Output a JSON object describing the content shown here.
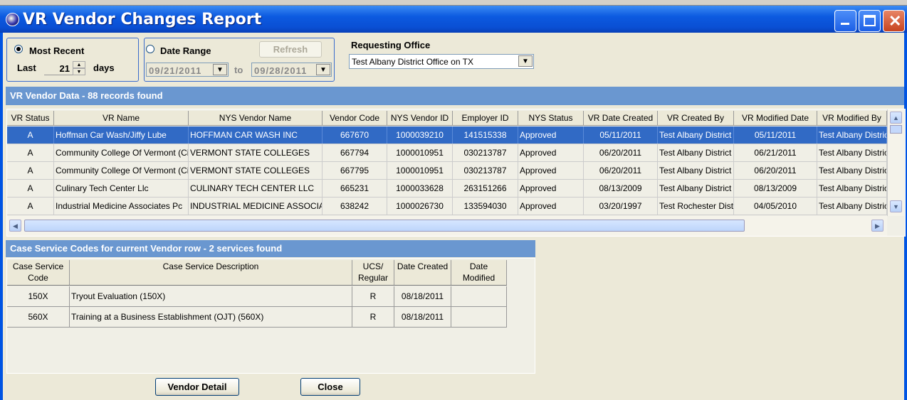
{
  "window": {
    "title": "VR Vendor Changes Report",
    "icon": "globe-icon"
  },
  "filters": {
    "most_recent_label": "Most Recent",
    "most_recent_selected": true,
    "last_label": "Last",
    "days_value": "21",
    "days_label": "days",
    "date_range_label": "Date Range",
    "date_range_selected": false,
    "from_date": "09/21/2011",
    "to_label": "to",
    "to_date": "09/28/2011",
    "refresh_label": "Refresh",
    "requesting_office_label": "Requesting Office",
    "requesting_office_value": "Test Albany District Office on TX"
  },
  "vendor_section": {
    "title": "VR Vendor Data - 88 records found",
    "columns": [
      "VR Status",
      "VR Name",
      "NYS Vendor Name",
      "Vendor Code",
      "NYS Vendor ID",
      "Employer ID",
      "NYS Status",
      "VR Date Created",
      "VR Created By",
      "VR Modified Date",
      "VR Modified By"
    ],
    "rows": [
      [
        "A",
        "Hoffman Car Wash/Jiffy Lube",
        "HOFFMAN CAR WASH INC",
        "667670",
        "1000039210",
        "141515338",
        "Approved",
        "05/11/2011",
        "Test Albany District",
        "05/11/2011",
        "Test Albany District"
      ],
      [
        "A",
        "Community College Of Vermont (Ci",
        "VERMONT STATE COLLEGES",
        "667794",
        "1000010951",
        "030213787",
        "Approved",
        "06/20/2011",
        "Test Albany District",
        "06/21/2011",
        "Test Albany District"
      ],
      [
        "A",
        "Community College Of Vermont (Ci",
        "VERMONT STATE COLLEGES",
        "667795",
        "1000010951",
        "030213787",
        "Approved",
        "06/20/2011",
        "Test Albany District",
        "06/20/2011",
        "Test Albany District"
      ],
      [
        "A",
        "Culinary Tech Center Llc",
        "CULINARY TECH CENTER LLC",
        "665231",
        "1000033628",
        "263151266",
        "Approved",
        "08/13/2009",
        "Test Albany District",
        "08/13/2009",
        "Test Albany District"
      ],
      [
        "A",
        "Industrial Medicine Associates Pc",
        "INDUSTRIAL MEDICINE ASSOCIATES",
        "638242",
        "1000026730",
        "133594030",
        "Approved",
        "03/20/1997",
        "Test Rochester District",
        "04/05/2010",
        "Test Albany District"
      ]
    ]
  },
  "services_section": {
    "title": "Case Service Codes for current Vendor row - 2 services found",
    "columns": [
      "Case Service Code",
      "Case Service Description",
      "UCS/ Regular",
      "Date Created",
      "Date Modified"
    ],
    "rows": [
      [
        "150X",
        "Tryout Evaluation (150X)",
        "R",
        "08/18/2011",
        ""
      ],
      [
        "560X",
        "Training at a Business Establishment (OJT) (560X)",
        "R",
        "08/18/2011",
        ""
      ]
    ]
  },
  "buttons": {
    "vendor_detail": "Vendor Detail",
    "close": "Close"
  }
}
